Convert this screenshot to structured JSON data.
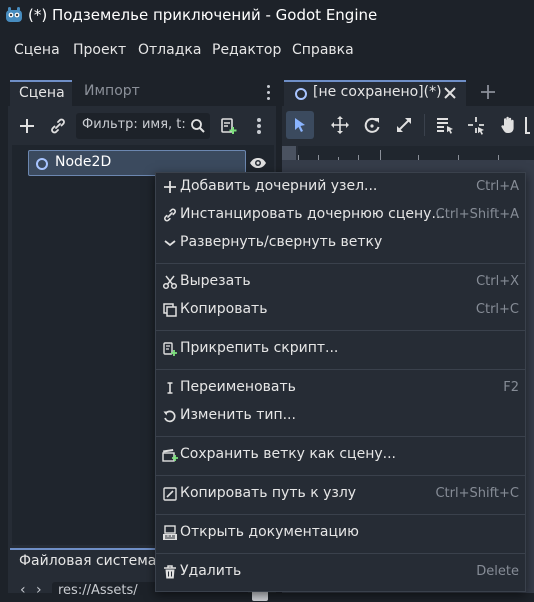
{
  "window": {
    "title": "(*) Подземелье приключений - Godot Engine"
  },
  "menubar": {
    "items": [
      "Сцена",
      "Проект",
      "Отладка",
      "Редактор",
      "Справка"
    ]
  },
  "scene_dock": {
    "tabs": [
      {
        "label": "Сцена",
        "active": true
      },
      {
        "label": "Импорт",
        "active": false
      }
    ],
    "filter_placeholder": "Фильтр: имя, t:",
    "tree": [
      {
        "label": "Node2D",
        "type": "Node2D",
        "selected": true
      }
    ]
  },
  "filesystem_dock": {
    "tab_label": "Файловая система",
    "path": "res://Assets/"
  },
  "viewport": {
    "tab_label": "[не сохранено](*)"
  },
  "context_menu": {
    "items": [
      {
        "label": "Добавить дочерний узел...",
        "shortcut": "Ctrl+A",
        "icon": "add-icon"
      },
      {
        "label": "Инстанцировать дочернюю сцену...",
        "shortcut": "Ctrl+Shift+A",
        "icon": "link-icon"
      },
      {
        "label": "Развернуть/свернуть ветку",
        "shortcut": "",
        "icon": "chevron-down-icon"
      },
      {
        "label": "Вырезать",
        "shortcut": "Ctrl+X",
        "icon": "scissors-icon"
      },
      {
        "label": "Копировать",
        "shortcut": "Ctrl+C",
        "icon": "copy-icon"
      },
      {
        "label": "Прикрепить скрипт...",
        "shortcut": "",
        "icon": "script-add-icon"
      },
      {
        "label": "Переименовать",
        "shortcut": "F2",
        "icon": "text-cursor-icon"
      },
      {
        "label": "Изменить тип...",
        "shortcut": "",
        "icon": "rotate-icon"
      },
      {
        "label": "Сохранить ветку как сцену...",
        "shortcut": "",
        "icon": "clapperboard-add-icon"
      },
      {
        "label": "Копировать путь к узлу",
        "shortcut": "Ctrl+Shift+C",
        "icon": "node-path-icon"
      },
      {
        "label": "Открыть документацию",
        "shortcut": "",
        "icon": "doc-icon"
      },
      {
        "label": "Удалить",
        "shortcut": "Delete",
        "icon": "trash-icon"
      }
    ]
  },
  "colors": {
    "accent": "#6f8fc7",
    "node_icon": "#a8c4ff",
    "script_green": "#7ee07e"
  }
}
